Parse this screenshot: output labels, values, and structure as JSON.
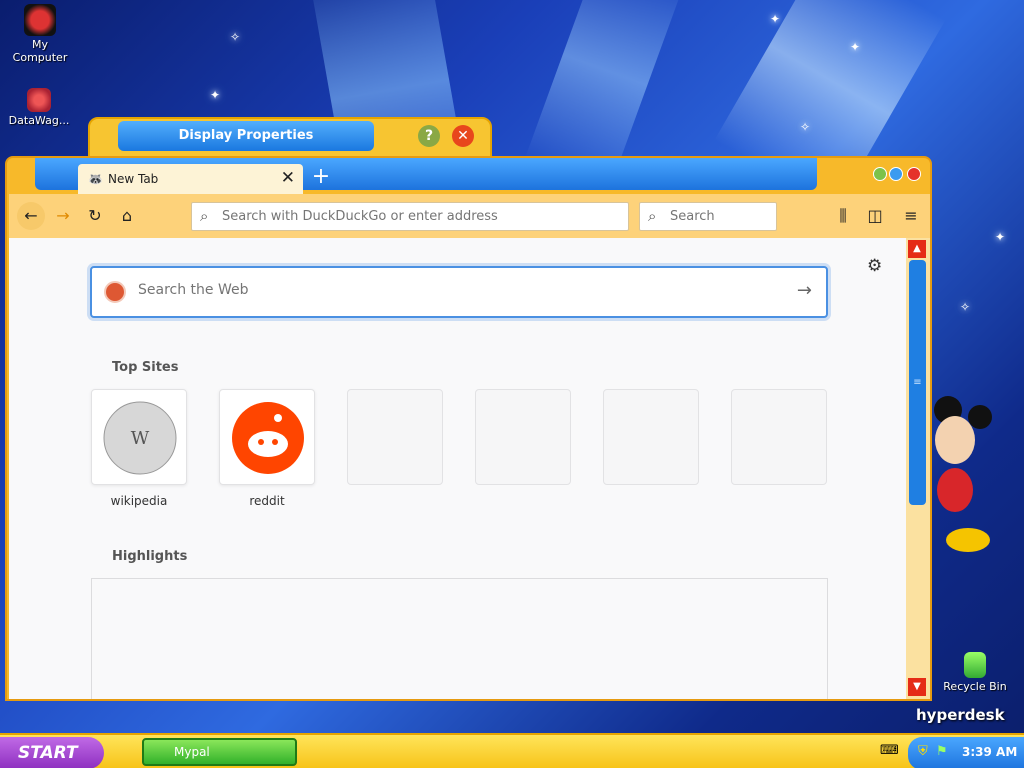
{
  "desktop": {
    "icons": [
      {
        "label": "My Computer"
      },
      {
        "label": "DataWag..."
      },
      {
        "label": "Recycle Bin"
      }
    ],
    "brand": "hyperdesk"
  },
  "display_properties": {
    "title": "Display Properties",
    "help_label": "?",
    "close_label": "✕"
  },
  "browser": {
    "tab": {
      "title": "New Tab",
      "close": "✕"
    },
    "new_tab": "+",
    "url_placeholder": "Search with DuckDuckGo or enter address",
    "search_placeholder": "Search",
    "web_search_placeholder": "Search the Web",
    "top_sites_title": "Top Sites",
    "top_sites": [
      {
        "label": "wikipedia"
      },
      {
        "label": "reddit"
      },
      {
        "label": ""
      },
      {
        "label": ""
      },
      {
        "label": ""
      },
      {
        "label": ""
      }
    ],
    "highlights_title": "Highlights"
  },
  "taskbar": {
    "start_label": "START",
    "task_label": "Mypal",
    "clock": "3:39 AM"
  },
  "colors": {
    "window_frame": "#f7b92a",
    "tab_strip": "#1d73dd",
    "scroll_arrow": "#e52b16",
    "taskbar": "#f7c419",
    "start": "#8e2fc0"
  }
}
